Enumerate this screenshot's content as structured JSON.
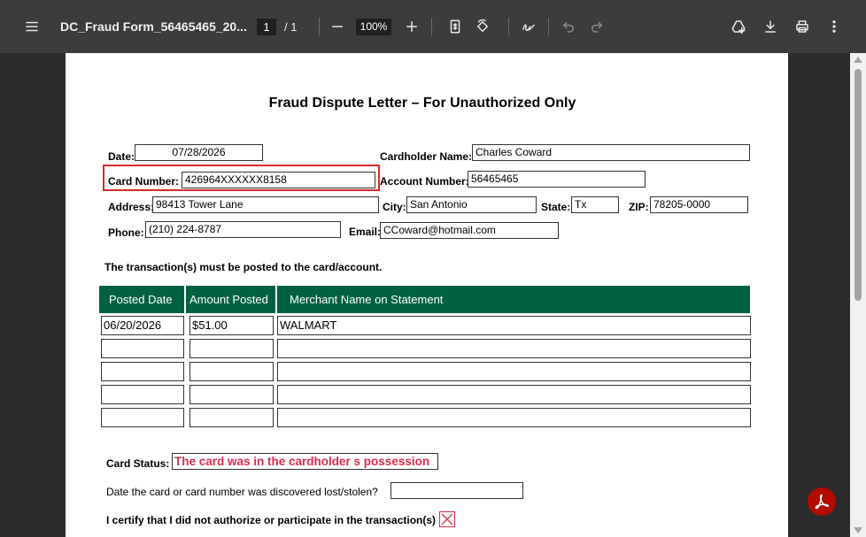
{
  "toolbar": {
    "title": "DC_Fraud Form_56465465_20...",
    "page_current": "1",
    "page_total": "/  1",
    "zoom": "100%",
    "icons": [
      "menu-icon",
      "minus-icon",
      "plus-icon",
      "fit-page-icon",
      "rotate-icon",
      "draw-icon",
      "undo-icon",
      "redo-icon",
      "drive-add-icon",
      "download-icon",
      "print-icon",
      "more-icon"
    ]
  },
  "form": {
    "title": "Fraud Dispute Letter – For Unauthorized Only",
    "date_label": "Date:",
    "date_value": "07/28/2026",
    "cardholder_label": "Cardholder Name:",
    "cardholder_value": "Charles Coward",
    "card_number_label": "Card Number:",
    "card_number_value": "426964XXXXXX8158",
    "account_label": "Account Number:",
    "account_value": "56465465",
    "address_label": "Address:",
    "address_value": "98413 Tower Lane",
    "city_label": "City:",
    "city_value": "San Antonio",
    "state_label": "State:",
    "state_value": "Tx",
    "zip_label": "ZIP:",
    "zip_value": "78205-0000",
    "phone_label": "Phone:",
    "phone_value": "(210) 224-8787",
    "email_label": "Email:",
    "email_value": "CCoward@hotmail.com",
    "posted_note": "The transaction(s) must be posted to the card/account.",
    "table": {
      "headers": [
        "Posted Date",
        "Amount Posted",
        "Merchant Name on Statement"
      ],
      "rows": [
        [
          "06/20/2026",
          "$51.00",
          "WALMART"
        ],
        [
          "",
          "",
          ""
        ],
        [
          "",
          "",
          ""
        ],
        [
          "",
          "",
          ""
        ],
        [
          "",
          "",
          ""
        ]
      ]
    },
    "card_status_label": "Card Status:",
    "card_status_value": "The card was in the cardholder s possession",
    "discovered_label": "Date the card or card number was discovered lost/stolen?",
    "discovered_value": "",
    "certify_label": "I certify that I did not authorize or participate in the transaction(s)"
  },
  "colors": {
    "toolbar": "#3c3c3c",
    "table_header": "#006241",
    "highlight": "#d62b2b",
    "status_text": "#dc2b4b"
  }
}
